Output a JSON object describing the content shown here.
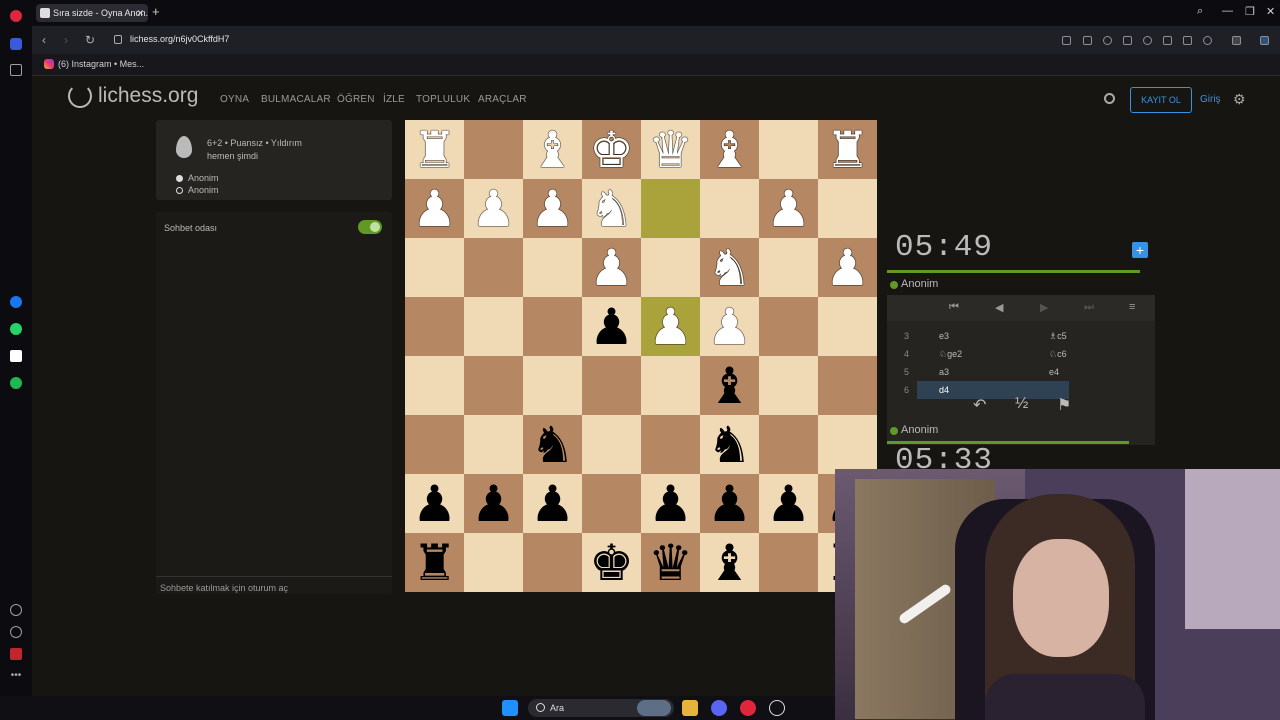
{
  "browser": {
    "tab_title": "Sıra sizde - Oyna Anon. -",
    "url": "lichess.org/n6jv0CkffdH7",
    "bookmark": "(6) Instagram • Mes..."
  },
  "header": {
    "logo": "lichess.org",
    "nav": [
      "OYNA",
      "BULMACALAR",
      "ÖĞREN",
      "İZLE",
      "TOPLULUK",
      "ARAÇLAR"
    ],
    "signup": "KAYIT OL",
    "signin": "Giriş"
  },
  "game_info": {
    "mode": "6+2 • Puansız • Yıldırım",
    "time": "hemen şimdi",
    "players": [
      "Anonim",
      "Anonim"
    ]
  },
  "chat": {
    "title": "Sohbet odası",
    "input_placeholder": "Sohbete katılmak için oturum aç"
  },
  "board": {
    "rows": [
      [
        [
          "w",
          "♜"
        ],
        null,
        [
          "w",
          "♝"
        ],
        [
          "w",
          "♚"
        ],
        [
          "w",
          "♛"
        ],
        [
          "w",
          "♝"
        ],
        null,
        [
          "w",
          "♜"
        ]
      ],
      [
        [
          "w",
          "♟"
        ],
        [
          "w",
          "♟"
        ],
        [
          "w",
          "♟"
        ],
        [
          "w",
          "♞"
        ],
        null,
        null,
        [
          "w",
          "♟"
        ],
        null
      ],
      [
        null,
        null,
        null,
        [
          "w",
          "♟"
        ],
        null,
        [
          "w",
          "♞"
        ],
        null,
        [
          "w",
          "♟"
        ]
      ],
      [
        null,
        null,
        null,
        [
          "b",
          "♟"
        ],
        [
          "w",
          "♟"
        ],
        [
          "w",
          "♟"
        ],
        null,
        null
      ],
      [
        null,
        null,
        null,
        null,
        null,
        [
          "b",
          "♝"
        ],
        null,
        null
      ],
      [
        null,
        null,
        [
          "b",
          "♞"
        ],
        null,
        null,
        [
          "b",
          "♞"
        ],
        null,
        null
      ],
      [
        [
          "b",
          "♟"
        ],
        [
          "b",
          "♟"
        ],
        [
          "b",
          "♟"
        ],
        null,
        [
          "b",
          "♟"
        ],
        [
          "b",
          "♟"
        ],
        [
          "b",
          "♟"
        ],
        [
          "b",
          "♟"
        ]
      ],
      [
        [
          "b",
          "♜"
        ],
        null,
        null,
        [
          "b",
          "♚"
        ],
        [
          "b",
          "♛"
        ],
        [
          "b",
          "♝"
        ],
        null,
        [
          "b",
          "♜"
        ]
      ]
    ],
    "highlight": [
      [
        1,
        4
      ],
      [
        3,
        4
      ]
    ]
  },
  "clocks": {
    "top": "05:49",
    "bottom": "05:33",
    "top_player": "Anonim",
    "bottom_player": "Anonim"
  },
  "moves": [
    {
      "n": "3",
      "w": "e3",
      "b": "♗c5"
    },
    {
      "n": "4",
      "w": "♘ge2",
      "b": "♘c6"
    },
    {
      "n": "5",
      "w": "a3",
      "b": "e4"
    },
    {
      "n": "6",
      "w": "d4",
      "b": ""
    }
  ],
  "move_actions": [
    "↶",
    "½",
    "⚑"
  ],
  "taskbar": {
    "search": "Ara"
  }
}
